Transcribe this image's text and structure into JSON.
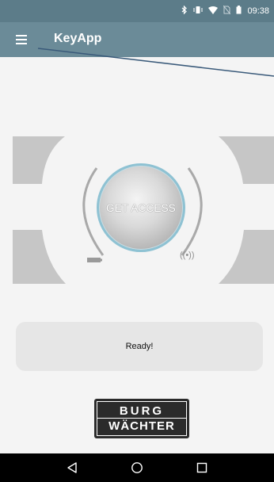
{
  "status_bar": {
    "time": "09:38",
    "icons": [
      "bluetooth-icon",
      "vibrate-icon",
      "wifi-icon",
      "no-sim-icon",
      "battery-icon"
    ]
  },
  "app_bar": {
    "title": "KeyApp",
    "menu_icon": "hamburger-menu-icon"
  },
  "access_panel": {
    "button_label": "GET ACCESS",
    "battery_icon": "battery-icon",
    "signal_icon": "wireless-signal-icon",
    "signal_glyph": "((•))"
  },
  "status": {
    "text": "Ready!"
  },
  "logo": {
    "line1": "BURG",
    "line2": "WÄCHTER"
  },
  "nav_bar": {
    "buttons": [
      "back-icon",
      "home-icon",
      "recents-icon"
    ]
  },
  "colors": {
    "status_bar": "#5c7c89",
    "app_bar": "#6b8b98",
    "background": "#f4f4f4",
    "panel_shapes": "#c6c6c6",
    "button_ring": "#8ec2d3",
    "status_box": "#e6e6e6",
    "logo_bg": "#2b2b2b"
  }
}
